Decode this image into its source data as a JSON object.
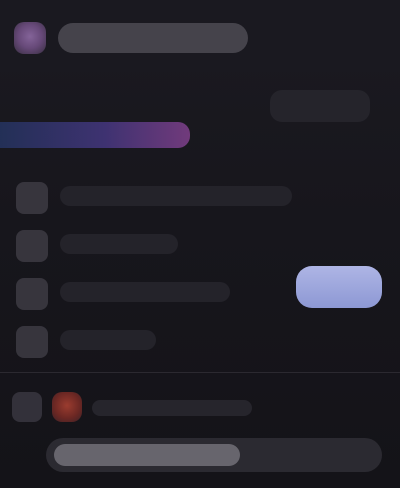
{
  "header": {
    "title": ""
  },
  "section": {
    "caption": "",
    "accent_label": "",
    "top_right_action": ""
  },
  "list": {
    "items": [
      {
        "label": ""
      },
      {
        "label": ""
      },
      {
        "label": ""
      },
      {
        "label": ""
      }
    ]
  },
  "cta": {
    "label": ""
  },
  "bottom": {
    "label": ""
  },
  "composer": {
    "value": "",
    "placeholder": ""
  },
  "colors": {
    "background": "#17161d",
    "accent_start": "#24325d",
    "accent_end": "#7b3e86",
    "cta": "#aeb5e5",
    "avatar": "#9b3c2f"
  },
  "icons": {
    "header_icon": "app-icon",
    "row_icons": [
      "list-item-icon",
      "list-item-icon",
      "list-item-icon",
      "list-item-icon"
    ],
    "bottom_icon": "menu-icon",
    "avatar_icon": "avatar"
  }
}
